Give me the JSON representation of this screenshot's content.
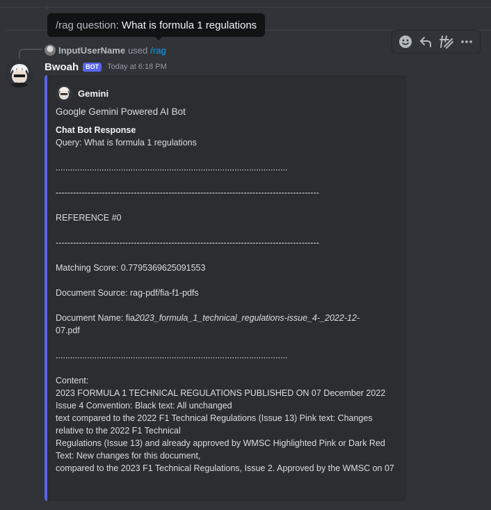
{
  "tooltip": {
    "command": "/rag question:",
    "value": "What is formula 1 regulations"
  },
  "reply": {
    "username": "InputUserName",
    "used": "used",
    "command": "/rag"
  },
  "message": {
    "author": "Bwoah",
    "bot_tag": "BOT",
    "timestamp": "Today at 6:18 PM"
  },
  "actions": [
    {
      "name": "add-reaction-icon"
    },
    {
      "name": "reply-icon"
    },
    {
      "name": "create-thread-icon"
    },
    {
      "name": "more-icon"
    }
  ],
  "embed": {
    "author": "Gemini",
    "title": "Google Gemini Powered AI Bot",
    "field_name": "Chat Bot Response",
    "query": "Query: What is formula 1 regulations",
    "dots1": "................................................................................................",
    "dashes1": "-------------------------------------------------------------------------------------------",
    "reference": "REFERENCE #0",
    "dashes2": "-------------------------------------------------------------------------------------------",
    "matching_score": "Matching Score: 0.7795369625091553",
    "document_source": "Document Source: rag-pdf/fia-f1-pdfs",
    "document_name_prefix": "Document Name: fia",
    "document_name_italic": "2023_formula_1_technical_regulations-issue_4-_2022-12-",
    "document_name_suffix": "07.pdf",
    "dots2": "................................................................................................",
    "content_label": "Content:",
    "content_lines": [
      "2023 FORMULA 1 TECHNICAL REGULATIONS PUBLISHED ON 07 December 2022",
      "Issue 4 Convention: Black text: All unchanged",
      "text compared to the 2022 F1 Technical Regulations (Issue 13) Pink text: Changes relative to the 2022 F1 Technical",
      "Regulations (Issue 13) and already approved by WMSC Highlighted Pink or Dark Red Text: New changes for this document,",
      "compared to the 2023 F1 Technical Regulations, Issue 2. Approved by the WMSC on 07"
    ]
  },
  "colors": {
    "accent": "#5865f2",
    "link": "#00a8fc",
    "background": "#313338",
    "embed_bg": "#2b2d31"
  }
}
